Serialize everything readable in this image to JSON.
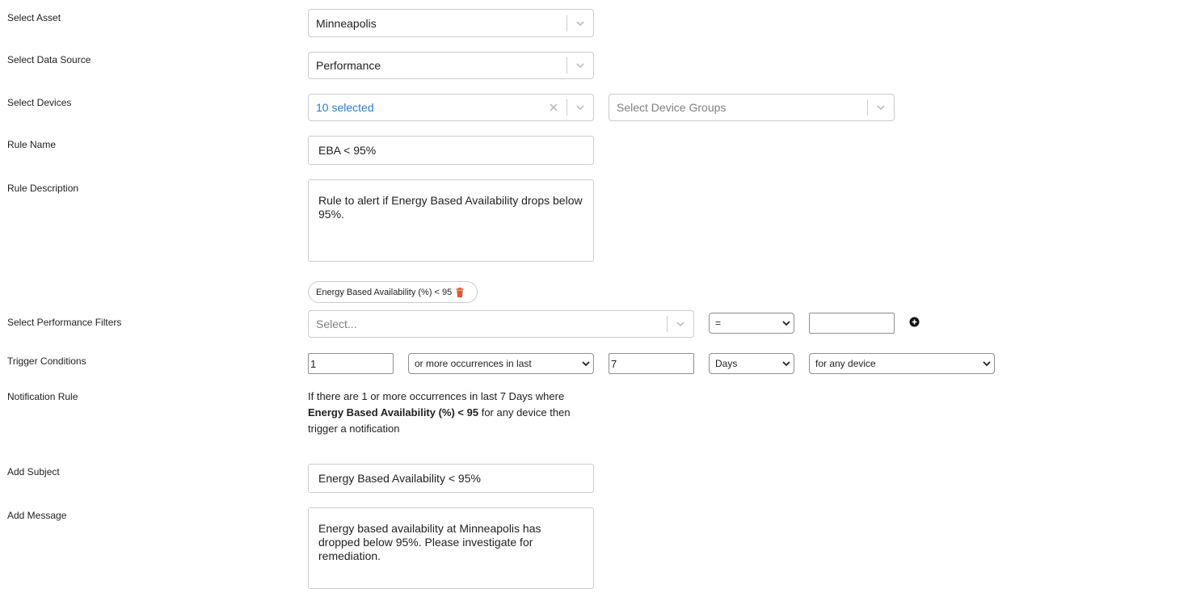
{
  "labels": {
    "asset": "Select Asset",
    "data_source": "Select Data Source",
    "devices": "Select Devices",
    "rule_name": "Rule Name",
    "rule_description": "Rule Description",
    "performance_filters": "Select Performance Filters",
    "trigger_conditions": "Trigger Conditions",
    "notification_rule": "Notification Rule",
    "add_subject": "Add Subject",
    "add_message": "Add Message"
  },
  "asset": {
    "value": "Minneapolis"
  },
  "data_source": {
    "value": "Performance"
  },
  "devices": {
    "value": "10 selected",
    "clear_icon": "close-icon"
  },
  "device_groups": {
    "placeholder": "Select Device Groups"
  },
  "rule_name": {
    "value": "EBA < 95%"
  },
  "rule_description": {
    "value": "Rule to alert if Energy Based Availability drops below 95%."
  },
  "filter_chip": {
    "label": "Energy Based Availability (%) < 95",
    "icon": "trash-icon",
    "icon_color": "#e05a2b"
  },
  "performance_filter": {
    "placeholder": "Select...",
    "operator": "=",
    "value": "",
    "add_icon": "plus-circle-icon"
  },
  "trigger": {
    "count": "1",
    "occurrence": "or more occurrences in last",
    "period": "7",
    "unit": "Days",
    "scope": "for any device"
  },
  "notification_rule": {
    "prefix": "If there are 1 or more occurrences in last 7 Days where",
    "condition": "Energy Based Availability (%) < 95",
    "suffix": "for any device then trigger a notification"
  },
  "subject": {
    "value": "Energy Based Availability < 95%"
  },
  "message": {
    "value": "Energy based availability at Minneapolis has dropped below 95%. Please investigate for remediation."
  },
  "colors": {
    "multi_value": "#2f7ad3",
    "border": "#cccccc"
  }
}
